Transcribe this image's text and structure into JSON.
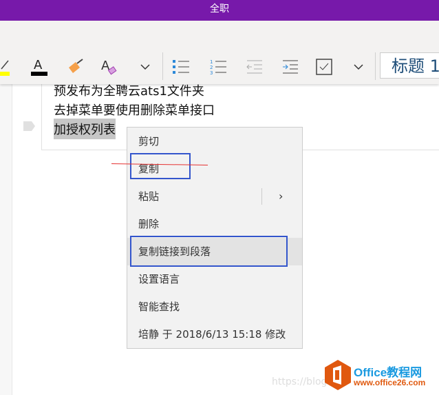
{
  "title": "全职",
  "ribbon": {
    "style_value": "标题 1"
  },
  "note": {
    "lines": [
      "预发布为全聘云ats1文件夹",
      "去掉菜单要使用删除菜单接口",
      "加授权列表"
    ]
  },
  "context_menu": {
    "items": [
      "剪切",
      "复制",
      "粘贴",
      "删除",
      "复制链接到段落",
      "设置语言",
      "智能查找",
      "培静 于 2018/6/13 15:18 修改"
    ]
  },
  "watermark": "https://blog.",
  "logo": {
    "line1": "Office教程网",
    "line2": "www.office26.com"
  },
  "colors": {
    "title_bar": "#7719aa",
    "annotation_box": "#3355cc",
    "annotation_line": "#e53030"
  }
}
